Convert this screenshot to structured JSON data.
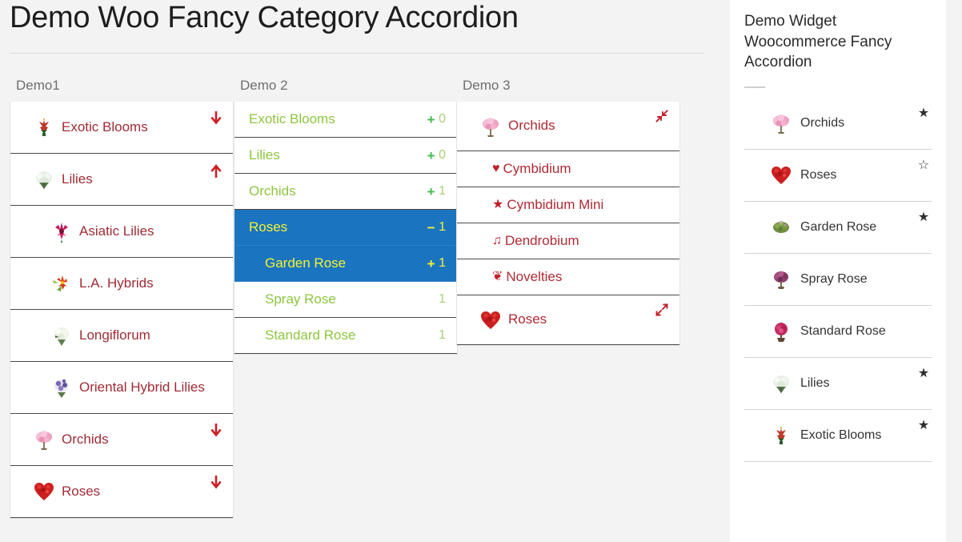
{
  "page": {
    "title": "Demo Woo Fancy Category Accordion",
    "background": "#f3f3f3",
    "accent_blue": "#1b74c0",
    "accent_green": "#8dc63f",
    "accent_red": "#b02a34",
    "accent_yellow": "#f2f231"
  },
  "columns": [
    {
      "heading": "Demo1",
      "style": "thumbs-arrows",
      "rows": [
        {
          "label": "Exotic Blooms",
          "level": 1,
          "thumb": "exotic-blooms",
          "control": "arrow-down-icon"
        },
        {
          "label": "Lilies",
          "level": 1,
          "thumb": "lilies",
          "control": "arrow-up-icon"
        },
        {
          "label": "Asiatic Lilies",
          "level": 2,
          "thumb": "asiatic-lilies",
          "control": "none"
        },
        {
          "label": "L.A. Hybrids",
          "level": 2,
          "thumb": "la-hybrids",
          "control": "none"
        },
        {
          "label": "Longiflorum",
          "level": 2,
          "thumb": "longiflorum",
          "control": "none"
        },
        {
          "label": "Oriental Hybrid Lilies",
          "level": 2,
          "thumb": "oriental-hybrid-lilies",
          "control": "none"
        },
        {
          "label": "Orchids",
          "level": 1,
          "thumb": "orchids",
          "control": "arrow-down-icon"
        },
        {
          "label": "Roses",
          "level": 1,
          "thumb": "roses",
          "control": "arrow-down-icon"
        }
      ]
    },
    {
      "heading": "Demo 2",
      "style": "text-counts",
      "rows": [
        {
          "label": "Exotic Blooms",
          "level": 1,
          "sign": "+",
          "count": "0",
          "active": false
        },
        {
          "label": "Lilies",
          "level": 1,
          "sign": "+",
          "count": "0",
          "active": false
        },
        {
          "label": "Orchids",
          "level": 1,
          "sign": "+",
          "count": "1",
          "active": false
        },
        {
          "label": "Roses",
          "level": 1,
          "sign": "−",
          "count": "1",
          "active": true
        },
        {
          "label": "Garden Rose",
          "level": 2,
          "sign": "+",
          "count": "1",
          "active": true
        },
        {
          "label": "Spray Rose",
          "level": 2,
          "sign": "",
          "count": "1",
          "active": false
        },
        {
          "label": "Standard Rose",
          "level": 2,
          "sign": "",
          "count": "1",
          "active": false
        }
      ]
    },
    {
      "heading": "Demo 3",
      "style": "glyphs",
      "rows": [
        {
          "label": "Orchids",
          "level": 1,
          "thumb": "orchids",
          "glyph": "",
          "control": "compress-icon"
        },
        {
          "label": "Cymbidium",
          "level": 2,
          "thumb": "",
          "glyph": "♥",
          "glyph_name": "heart-icon",
          "control": "none"
        },
        {
          "label": "Cymbidium Mini",
          "level": 2,
          "thumb": "",
          "glyph": "★",
          "glyph_name": "star-icon",
          "control": "none"
        },
        {
          "label": "Dendrobium",
          "level": 2,
          "thumb": "",
          "glyph": "♫",
          "glyph_name": "music-note-icon",
          "control": "none"
        },
        {
          "label": "Novelties",
          "level": 2,
          "thumb": "",
          "glyph": "❦",
          "glyph_name": "leaf-icon",
          "control": "none"
        },
        {
          "label": "Roses",
          "level": 1,
          "thumb": "roses",
          "glyph": "",
          "control": "expand-icon"
        }
      ]
    }
  ],
  "sidebar": {
    "title": "Demo Widget Woocommerce Fancy Accordion",
    "items": [
      {
        "label": "Orchids",
        "thumb": "orchids",
        "star": "filled"
      },
      {
        "label": "Roses",
        "thumb": "roses",
        "star": "outline"
      },
      {
        "label": "Garden Rose",
        "thumb": "garden-rose",
        "star": "filled"
      },
      {
        "label": "Spray Rose",
        "thumb": "spray-rose",
        "star": "none"
      },
      {
        "label": "Standard Rose",
        "thumb": "standard-rose",
        "star": "none"
      },
      {
        "label": "Lilies",
        "thumb": "lilies",
        "star": "filled"
      },
      {
        "label": "Exotic Blooms",
        "thumb": "exotic-blooms",
        "star": "filled"
      }
    ]
  }
}
